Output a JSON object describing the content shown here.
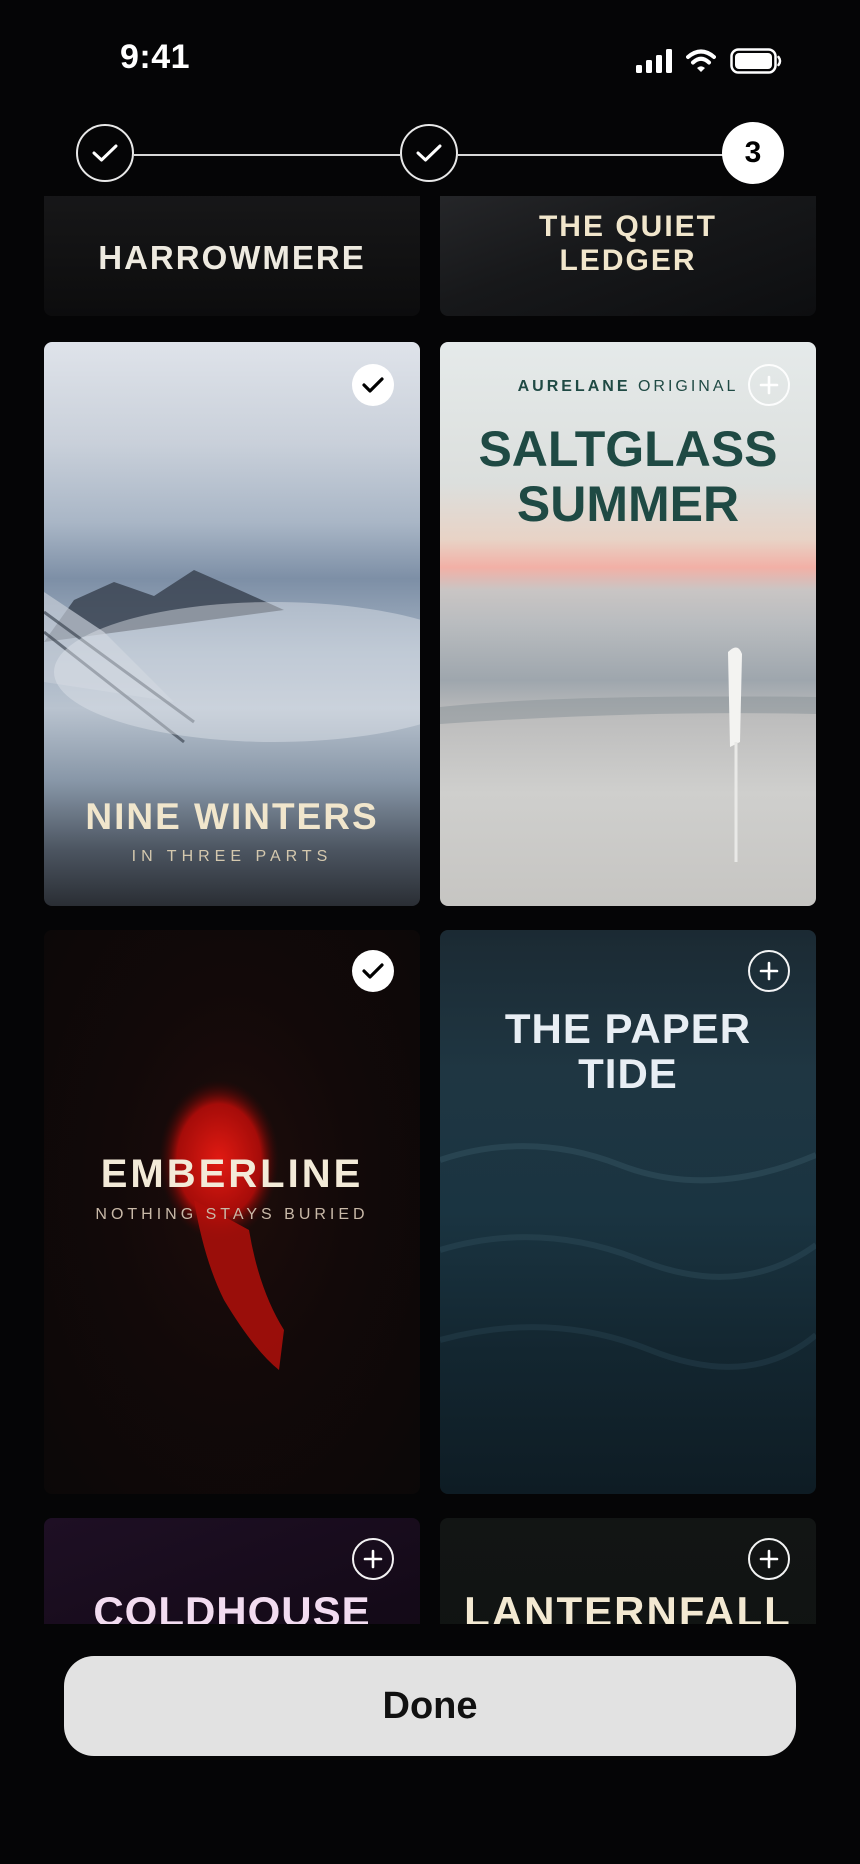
{
  "status_bar": {
    "time": "9:41"
  },
  "stepper": {
    "steps": [
      {
        "state": "done"
      },
      {
        "state": "done"
      },
      {
        "state": "current",
        "label": "3"
      }
    ]
  },
  "cards": {
    "harrowmere": {
      "title": "HARROWMERE"
    },
    "quiet_ledger": {
      "title_line1": "THE QUIET",
      "title_line2": "LEDGER"
    },
    "nine_winters": {
      "title": "NINE WINTERS",
      "subtitle": "IN THREE PARTS",
      "selected": true
    },
    "saltglass": {
      "brand_bold": "AURELANE",
      "brand_light": "ORIGINAL",
      "title_line1": "SALTGLASS",
      "title_line2": "SUMMER",
      "selected": false
    },
    "emberline": {
      "title": "EMBERLINE",
      "subtitle": "NOTHING STAYS BURIED",
      "selected": true
    },
    "paper_tide": {
      "title_line1": "THE PAPER",
      "title_line2": "TIDE",
      "selected": false
    },
    "coldhouse": {
      "title": "COLDHOUSE",
      "selected": false
    },
    "lanternfall": {
      "title": "LANTERNFALL",
      "selected": false
    }
  },
  "done_button": {
    "label": "Done"
  },
  "colors": {
    "background": "#050506",
    "button": "#e2e2e2",
    "cream_title": "#f1e6cc",
    "saltglass_title": "#1f4a44",
    "emberline_red": "#d81a14"
  }
}
